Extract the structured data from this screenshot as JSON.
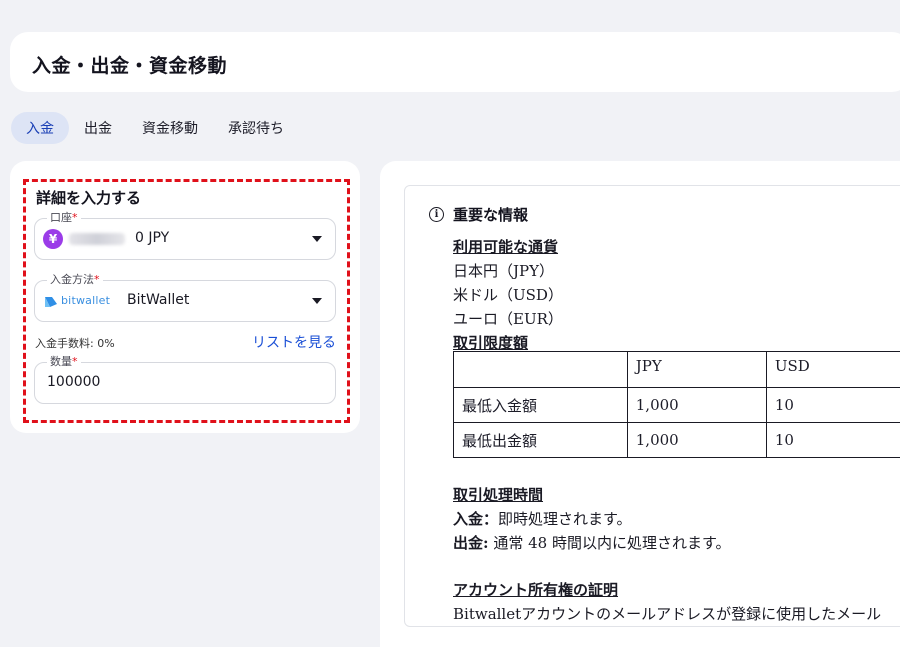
{
  "header": {
    "title": "入金・出金・資金移動"
  },
  "tabs": [
    {
      "label": "入金",
      "active": true
    },
    {
      "label": "出金",
      "active": false
    },
    {
      "label": "資金移動",
      "active": false
    },
    {
      "label": "承認待ち",
      "active": false
    }
  ],
  "form": {
    "section_title": "詳細を入力する",
    "account": {
      "label": "口座",
      "required_mark": "*",
      "value": "0 JPY",
      "icon": "yen-icon"
    },
    "method": {
      "label": "入金方法",
      "required_mark": "*",
      "logo_text": "bitwallet",
      "value": "BitWallet",
      "icon": "bitwallet-icon"
    },
    "fee_text": "入金手数料: 0%",
    "list_link": "リストを見る",
    "quantity": {
      "label": "数量",
      "required_mark": "*",
      "value": "100000"
    }
  },
  "info": {
    "title": "重要な情報",
    "currencies_heading": "利用可能な通貨",
    "currencies": [
      "日本円（JPY）",
      "米ドル（USD）",
      "ユーロ（EUR）"
    ],
    "limits_heading": "取引限度額",
    "limits_table": {
      "headers": [
        "",
        "JPY",
        "USD"
      ],
      "rows": [
        [
          "最低入金額",
          "1,000",
          "10"
        ],
        [
          "最低出金額",
          "1,000",
          "10"
        ]
      ]
    },
    "processing_heading": "取引処理時間",
    "deposit_label": "入金：",
    "deposit_text": "即時処理されます。",
    "withdraw_label": "出金:",
    "withdraw_text": " 通常 48 時間以内に処理されます。",
    "ownership_heading": "アカウント所有権の証明",
    "ownership_text": "Bitwalletアカウントのメールアドレスが登録に使用したメール"
  },
  "colors": {
    "accent": "#1a4fd6",
    "tab_active_bg": "#dde4f5",
    "dash_border": "#e0101a",
    "yen_badge": "#9b3ce8"
  }
}
